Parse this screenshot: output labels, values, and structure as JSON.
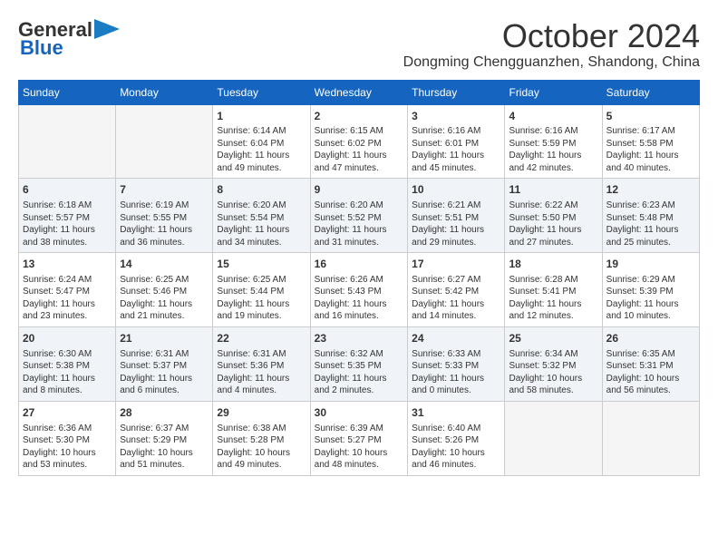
{
  "header": {
    "logo_general": "General",
    "logo_blue": "Blue",
    "month_year": "October 2024",
    "location": "Dongming Chengguanzhen, Shandong, China"
  },
  "days_of_week": [
    "Sunday",
    "Monday",
    "Tuesday",
    "Wednesday",
    "Thursday",
    "Friday",
    "Saturday"
  ],
  "weeks": [
    [
      {
        "day": "",
        "content": ""
      },
      {
        "day": "",
        "content": ""
      },
      {
        "day": "1",
        "content": "Sunrise: 6:14 AM\nSunset: 6:04 PM\nDaylight: 11 hours and 49 minutes."
      },
      {
        "day": "2",
        "content": "Sunrise: 6:15 AM\nSunset: 6:02 PM\nDaylight: 11 hours and 47 minutes."
      },
      {
        "day": "3",
        "content": "Sunrise: 6:16 AM\nSunset: 6:01 PM\nDaylight: 11 hours and 45 minutes."
      },
      {
        "day": "4",
        "content": "Sunrise: 6:16 AM\nSunset: 5:59 PM\nDaylight: 11 hours and 42 minutes."
      },
      {
        "day": "5",
        "content": "Sunrise: 6:17 AM\nSunset: 5:58 PM\nDaylight: 11 hours and 40 minutes."
      }
    ],
    [
      {
        "day": "6",
        "content": "Sunrise: 6:18 AM\nSunset: 5:57 PM\nDaylight: 11 hours and 38 minutes."
      },
      {
        "day": "7",
        "content": "Sunrise: 6:19 AM\nSunset: 5:55 PM\nDaylight: 11 hours and 36 minutes."
      },
      {
        "day": "8",
        "content": "Sunrise: 6:20 AM\nSunset: 5:54 PM\nDaylight: 11 hours and 34 minutes."
      },
      {
        "day": "9",
        "content": "Sunrise: 6:20 AM\nSunset: 5:52 PM\nDaylight: 11 hours and 31 minutes."
      },
      {
        "day": "10",
        "content": "Sunrise: 6:21 AM\nSunset: 5:51 PM\nDaylight: 11 hours and 29 minutes."
      },
      {
        "day": "11",
        "content": "Sunrise: 6:22 AM\nSunset: 5:50 PM\nDaylight: 11 hours and 27 minutes."
      },
      {
        "day": "12",
        "content": "Sunrise: 6:23 AM\nSunset: 5:48 PM\nDaylight: 11 hours and 25 minutes."
      }
    ],
    [
      {
        "day": "13",
        "content": "Sunrise: 6:24 AM\nSunset: 5:47 PM\nDaylight: 11 hours and 23 minutes."
      },
      {
        "day": "14",
        "content": "Sunrise: 6:25 AM\nSunset: 5:46 PM\nDaylight: 11 hours and 21 minutes."
      },
      {
        "day": "15",
        "content": "Sunrise: 6:25 AM\nSunset: 5:44 PM\nDaylight: 11 hours and 19 minutes."
      },
      {
        "day": "16",
        "content": "Sunrise: 6:26 AM\nSunset: 5:43 PM\nDaylight: 11 hours and 16 minutes."
      },
      {
        "day": "17",
        "content": "Sunrise: 6:27 AM\nSunset: 5:42 PM\nDaylight: 11 hours and 14 minutes."
      },
      {
        "day": "18",
        "content": "Sunrise: 6:28 AM\nSunset: 5:41 PM\nDaylight: 11 hours and 12 minutes."
      },
      {
        "day": "19",
        "content": "Sunrise: 6:29 AM\nSunset: 5:39 PM\nDaylight: 11 hours and 10 minutes."
      }
    ],
    [
      {
        "day": "20",
        "content": "Sunrise: 6:30 AM\nSunset: 5:38 PM\nDaylight: 11 hours and 8 minutes."
      },
      {
        "day": "21",
        "content": "Sunrise: 6:31 AM\nSunset: 5:37 PM\nDaylight: 11 hours and 6 minutes."
      },
      {
        "day": "22",
        "content": "Sunrise: 6:31 AM\nSunset: 5:36 PM\nDaylight: 11 hours and 4 minutes."
      },
      {
        "day": "23",
        "content": "Sunrise: 6:32 AM\nSunset: 5:35 PM\nDaylight: 11 hours and 2 minutes."
      },
      {
        "day": "24",
        "content": "Sunrise: 6:33 AM\nSunset: 5:33 PM\nDaylight: 11 hours and 0 minutes."
      },
      {
        "day": "25",
        "content": "Sunrise: 6:34 AM\nSunset: 5:32 PM\nDaylight: 10 hours and 58 minutes."
      },
      {
        "day": "26",
        "content": "Sunrise: 6:35 AM\nSunset: 5:31 PM\nDaylight: 10 hours and 56 minutes."
      }
    ],
    [
      {
        "day": "27",
        "content": "Sunrise: 6:36 AM\nSunset: 5:30 PM\nDaylight: 10 hours and 53 minutes."
      },
      {
        "day": "28",
        "content": "Sunrise: 6:37 AM\nSunset: 5:29 PM\nDaylight: 10 hours and 51 minutes."
      },
      {
        "day": "29",
        "content": "Sunrise: 6:38 AM\nSunset: 5:28 PM\nDaylight: 10 hours and 49 minutes."
      },
      {
        "day": "30",
        "content": "Sunrise: 6:39 AM\nSunset: 5:27 PM\nDaylight: 10 hours and 48 minutes."
      },
      {
        "day": "31",
        "content": "Sunrise: 6:40 AM\nSunset: 5:26 PM\nDaylight: 10 hours and 46 minutes."
      },
      {
        "day": "",
        "content": ""
      },
      {
        "day": "",
        "content": ""
      }
    ]
  ]
}
